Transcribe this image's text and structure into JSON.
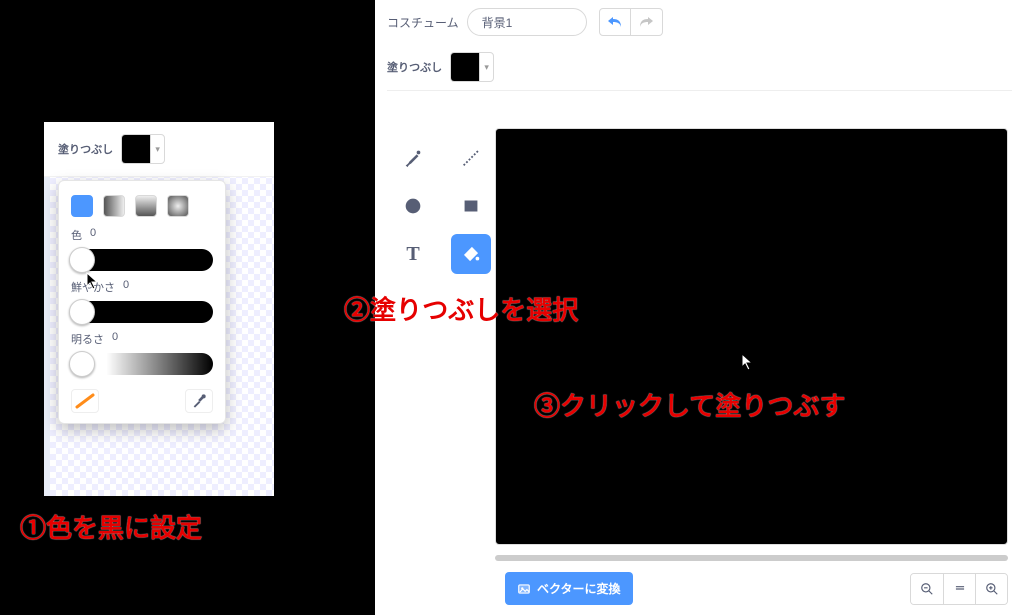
{
  "topbar": {
    "costume_label": "コスチューム",
    "costume_value": "背景1"
  },
  "fill": {
    "label": "塗りつぶし",
    "swatch_color": "#000000"
  },
  "tools": {
    "brush": "brush",
    "line": "line",
    "circle": "circle",
    "rect": "rect",
    "text_glyph": "T",
    "fill": "fill"
  },
  "bottom": {
    "vector_label": "ベクターに変換"
  },
  "picker": {
    "hue_label": "色",
    "hue_value": "0",
    "sat_label": "鮮やかさ",
    "sat_value": "0",
    "bri_label": "明るさ",
    "bri_value": "0"
  },
  "annotations": {
    "a1": "①色を黒に設定",
    "a2": "②塗りつぶしを選択",
    "a3": "③クリックして塗りつぶす"
  }
}
